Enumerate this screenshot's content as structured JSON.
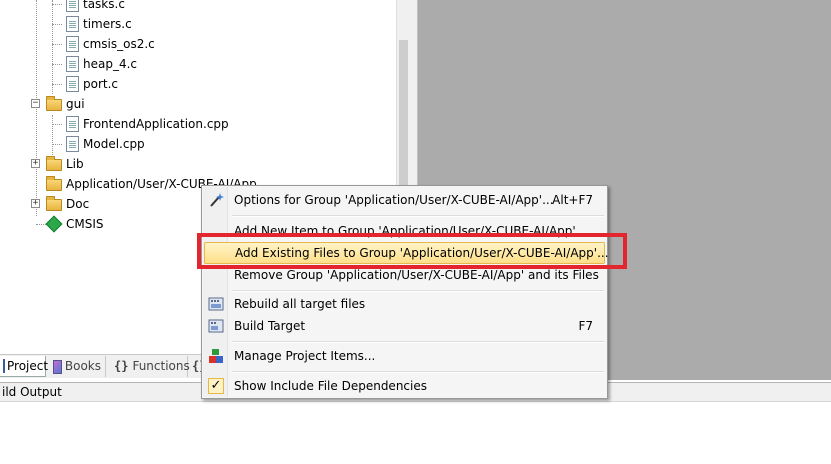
{
  "tree": {
    "items": [
      {
        "label": "tasks.c",
        "kind": "file"
      },
      {
        "label": "timers.c",
        "kind": "file"
      },
      {
        "label": "cmsis_os2.c",
        "kind": "file"
      },
      {
        "label": "heap_4.c",
        "kind": "file"
      },
      {
        "label": "port.c",
        "kind": "file"
      },
      {
        "label": "gui",
        "kind": "folder"
      },
      {
        "label": "FrontendApplication.cpp",
        "kind": "file"
      },
      {
        "label": "Model.cpp",
        "kind": "file"
      },
      {
        "label": "Lib",
        "kind": "folder"
      },
      {
        "label": "Application/User/X-CUBE-AI/App",
        "kind": "folder"
      },
      {
        "label": "Doc",
        "kind": "folder"
      },
      {
        "label": "CMSIS",
        "kind": "component"
      }
    ]
  },
  "tabs": [
    {
      "label": "Project",
      "icon": "project-icon",
      "active": true
    },
    {
      "label": "Books",
      "icon": "books-icon",
      "active": false
    },
    {
      "label": "Functions",
      "icon": "braces-icon",
      "active": false
    },
    {
      "label": "{}",
      "icon": "",
      "active": false
    }
  ],
  "build_output": {
    "title": "ild Output"
  },
  "context_menu": {
    "items": [
      {
        "label": "Options for Group 'Application/User/X-CUBE-AI/App'...",
        "shortcut": "Alt+F7",
        "icon": "magic-wand-icon"
      },
      {
        "label": "Add New  Item to Group 'Application/User/X-CUBE-AI/App'...",
        "shortcut": "",
        "icon": ""
      },
      {
        "label": "Add Existing Files to Group 'Application/User/X-CUBE-AI/App'...",
        "shortcut": "",
        "icon": "",
        "highlighted": true
      },
      {
        "label": "Remove Group 'Application/User/X-CUBE-AI/App' and its Files",
        "shortcut": "",
        "icon": ""
      },
      {
        "label": "Rebuild all target files",
        "shortcut": "",
        "icon": "rebuild-icon"
      },
      {
        "label": "Build Target",
        "shortcut": "F7",
        "icon": "build-icon"
      },
      {
        "label": "Manage Project Items...",
        "shortcut": "",
        "icon": "manage-items-icon"
      },
      {
        "label": "Show Include File Dependencies",
        "shortcut": "",
        "icon": "checkmark-icon"
      }
    ]
  },
  "colors": {
    "highlight": "#ffe08a",
    "annotation_box": "#e3262e",
    "editor_background": "#ababab"
  }
}
